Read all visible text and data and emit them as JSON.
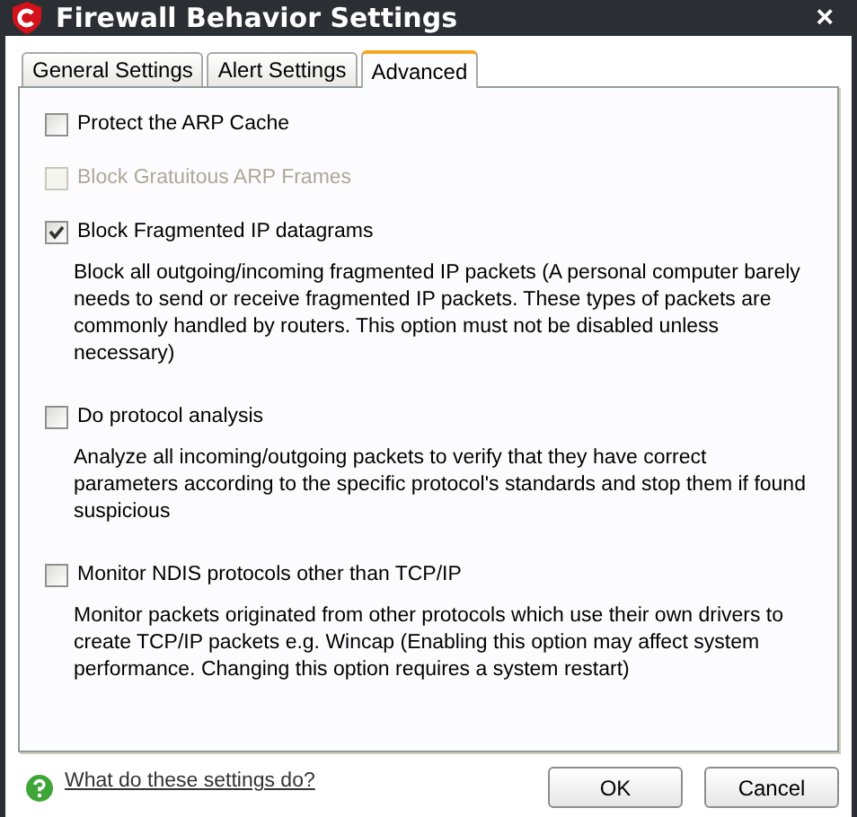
{
  "window": {
    "title": "Firewall Behavior Settings",
    "close": "×"
  },
  "tabs": [
    {
      "label": "General Settings",
      "selected": false
    },
    {
      "label": "Alert Settings",
      "selected": false
    },
    {
      "label": "Advanced",
      "selected": true
    }
  ],
  "options": [
    {
      "label": "Protect the ARP Cache",
      "checked": false,
      "disabled": false
    },
    {
      "label": "Block Gratuitous ARP Frames",
      "checked": false,
      "disabled": true
    },
    {
      "label": "Block Fragmented IP datagrams",
      "checked": true,
      "disabled": false,
      "description": "Block all outgoing/incoming fragmented IP packets (A personal computer barely needs to send or receive fragmented IP packets. These types of packets are commonly handled by routers. This option must not be disabled unless necessary)"
    },
    {
      "label": "Do protocol analysis",
      "checked": false,
      "disabled": false,
      "description": "Analyze all incoming/outgoing packets to verify that they have correct parameters according to the specific protocol's standards and stop them if found suspicious"
    },
    {
      "label": "Monitor NDIS protocols other than TCP/IP",
      "checked": false,
      "disabled": false,
      "description": "Monitor packets originated from other protocols which use their own drivers to create TCP/IP packets e.g. Wincap (Enabling this option may affect system performance. Changing this option requires a system restart)"
    }
  ],
  "help_link": "What do these settings do?",
  "buttons": [
    "OK",
    "Cancel"
  ]
}
